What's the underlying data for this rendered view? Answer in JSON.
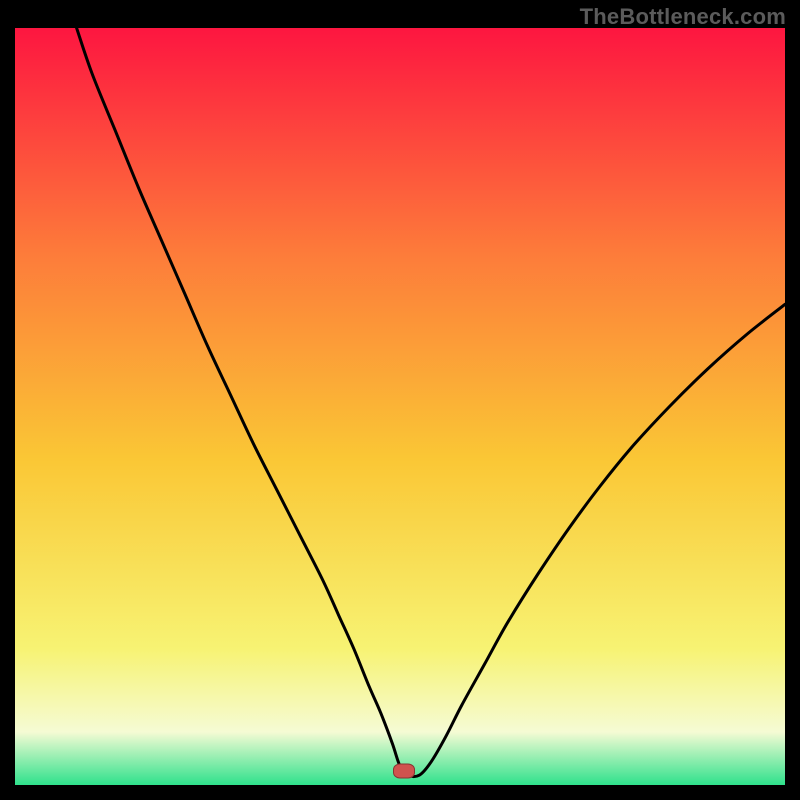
{
  "watermark": "TheBottleneck.com",
  "colors": {
    "gradient_top": "#fd1640",
    "gradient_mid_upper": "#fd7c3a",
    "gradient_mid": "#fac735",
    "gradient_mid_lower": "#f7f373",
    "gradient_pale": "#f5fbd4",
    "gradient_bottom": "#2fe18c",
    "curve": "#000000",
    "marker_fill": "#cf534e",
    "frame": "#000000"
  },
  "marker": {
    "x_frac": 0.505,
    "y_frac": 0.982
  },
  "chart_data": {
    "type": "line",
    "title": "",
    "xlabel": "",
    "ylabel": "",
    "xlim": [
      0,
      100
    ],
    "ylim": [
      0,
      100
    ],
    "series": [
      {
        "name": "bottleneck-curve",
        "x": [
          8,
          10,
          13,
          16,
          19,
          22,
          25,
          28,
          31,
          34,
          37,
          40,
          42,
          44,
          46,
          47.5,
          49,
          50,
          51,
          52.5,
          54,
          56,
          58,
          61,
          64,
          68,
          72,
          76,
          80,
          85,
          90,
          95,
          100
        ],
        "y": [
          100,
          94,
          86.5,
          79,
          72,
          65,
          58,
          51.5,
          45,
          39,
          33,
          27,
          22.5,
          18,
          13,
          9.5,
          5.5,
          2.5,
          1.3,
          1.3,
          3,
          6.5,
          10.5,
          16,
          21.5,
          28,
          34,
          39.5,
          44.5,
          50,
          55,
          59.5,
          63.5
        ]
      }
    ],
    "annotations": [
      {
        "name": "minimum-marker",
        "x": 50.5,
        "y": 1.3
      }
    ]
  }
}
